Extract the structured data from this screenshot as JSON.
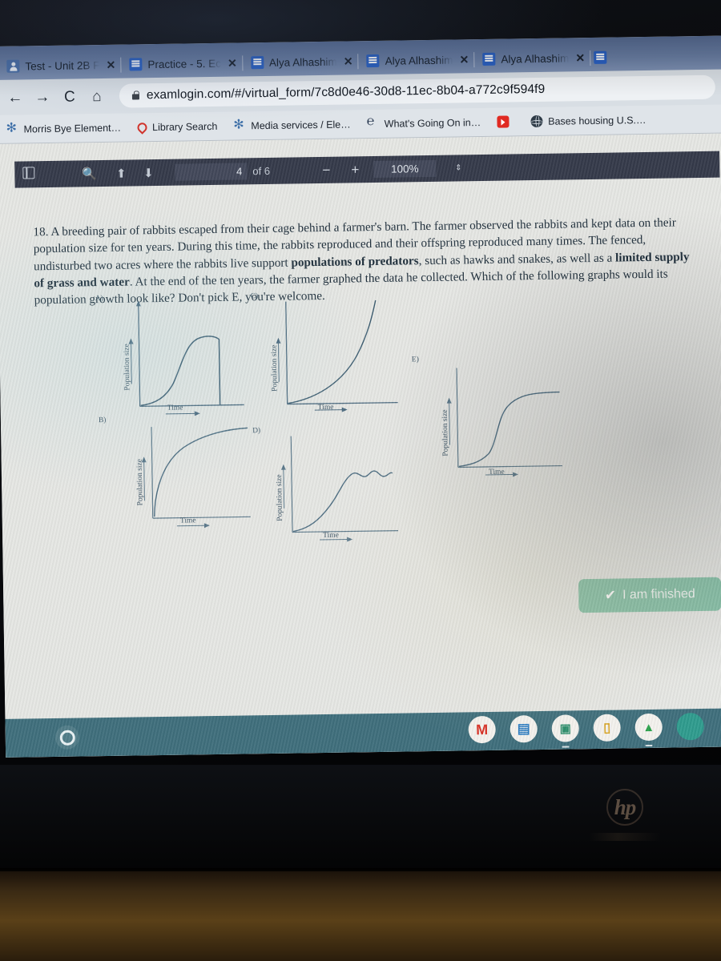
{
  "browser": {
    "tabs": [
      {
        "title": "Test - Unit 2B F",
        "favicon": "person-icon",
        "active": false,
        "close": "✕"
      },
      {
        "title": "Practice - 5. Ec",
        "favicon": "docs-icon",
        "active": false,
        "close": "✕"
      },
      {
        "title": "Alya Alhashim",
        "favicon": "docs-icon",
        "active": false,
        "close": "✕"
      },
      {
        "title": "Alya Alhashim",
        "favicon": "docs-icon",
        "active": false,
        "close": "✕"
      },
      {
        "title": "Alya Alhashim",
        "favicon": "docs-icon",
        "active": false,
        "close": "✕"
      },
      {
        "title": "",
        "favicon": "docs-icon",
        "active": false,
        "close": ""
      }
    ],
    "nav": {
      "back": "←",
      "forward": "→",
      "reload": "C",
      "home": "⌂"
    },
    "omnibox": {
      "url": "examlogin.com/#/virtual_form/7c8d0e46-30d8-11ec-8b04-a772c9f594f9",
      "lock_icon": "lock-icon"
    },
    "bookmarks": [
      {
        "label": "Morris Bye Element…",
        "icon": "leaf-icon"
      },
      {
        "label": "Library Search",
        "icon": "drop-icon"
      },
      {
        "label": "Media services / Ele…",
        "icon": "leaf-icon"
      },
      {
        "label": "What's Going On in…",
        "icon": "scroll-icon"
      },
      {
        "label": "",
        "icon": "youtube-icon"
      },
      {
        "label": "Bases housing U.S.…",
        "icon": "globe-icon"
      }
    ]
  },
  "pdf_toolbar": {
    "sidebar_toggle": "sidebar-toggle-icon",
    "find": "🔍",
    "prev_page": "⬆",
    "next_page": "⬇",
    "page_number": "4",
    "page_of": "of 6",
    "zoom_out": "−",
    "zoom_in": "+",
    "zoom_level": "100%",
    "zoom_select": "⇕"
  },
  "question": {
    "number": "18.",
    "part1": "18. A breeding pair of rabbits escaped from their cage behind a farmer's barn. The farmer observed the rabbits and kept data on their population size for ten years. During this time, the rabbits reproduced and their offspring reproduced many times. The fenced, undisturbed two acres where the rabbits live support ",
    "bold1": "populations of predators",
    "part2": ", such as hawks and snakes, as well as a ",
    "bold2": "limited supply of grass and water",
    "part3": ". At the end of the ten years, the farmer graphed the data he collected. Which of the following graphs would its population growth look like? Don't pick E, you're welcome."
  },
  "chart_data": [
    {
      "id": "A",
      "option_label": "A)",
      "type": "line",
      "title": "",
      "xlabel": "Time",
      "ylabel": "Population size",
      "description": "logistic rise to a peak followed by a sudden vertical crash",
      "x": [
        0,
        10,
        20,
        30,
        40,
        50,
        60,
        70,
        80,
        88,
        92,
        92
      ],
      "y": [
        0,
        3,
        7,
        14,
        27,
        45,
        62,
        73,
        78,
        79,
        78,
        0
      ],
      "xlim": [
        0,
        100
      ],
      "ylim": [
        0,
        100
      ],
      "grid": false
    },
    {
      "id": "B",
      "option_label": "B)",
      "type": "line",
      "title": "",
      "xlabel": "Time",
      "ylabel": "Population size",
      "description": "near-vertical initial rise then concave plateau (saturation)",
      "x": [
        5,
        6,
        10,
        18,
        30,
        45,
        60,
        78,
        95
      ],
      "y": [
        0,
        22,
        45,
        62,
        74,
        82,
        87,
        90,
        92
      ],
      "xlim": [
        0,
        100
      ],
      "ylim": [
        0,
        100
      ],
      "grid": false
    },
    {
      "id": "C",
      "option_label": "C)",
      "type": "line",
      "title": "",
      "xlabel": "Time",
      "ylabel": "Population size",
      "description": "exponential J-curve, no plateau",
      "x": [
        0,
        15,
        30,
        45,
        58,
        68,
        76,
        82,
        86,
        88
      ],
      "y": [
        0,
        4,
        10,
        19,
        31,
        45,
        62,
        80,
        94,
        100
      ],
      "xlim": [
        0,
        100
      ],
      "ylim": [
        0,
        100
      ],
      "grid": false
    },
    {
      "id": "D",
      "option_label": "D)",
      "type": "line",
      "title": "",
      "xlabel": "Time",
      "ylabel": "Population size",
      "description": "logistic growth then oscillation around carrying capacity",
      "x": [
        0,
        12,
        24,
        36,
        46,
        54,
        60,
        64,
        68,
        72,
        76,
        80,
        84,
        88,
        92
      ],
      "y": [
        0,
        4,
        10,
        22,
        38,
        54,
        66,
        72,
        68,
        74,
        67,
        74,
        66,
        73,
        69
      ],
      "xlim": [
        0,
        100
      ],
      "ylim": [
        0,
        100
      ],
      "grid": false
    },
    {
      "id": "E",
      "option_label": "E)",
      "type": "line",
      "title": "",
      "xlabel": "Time",
      "ylabel": "Population size",
      "description": "classic sigmoid S-curve levelling at carrying capacity",
      "x": [
        0,
        12,
        24,
        34,
        40,
        45,
        50,
        56,
        64,
        74,
        86,
        96
      ],
      "y": [
        2,
        4,
        7,
        12,
        22,
        40,
        58,
        70,
        77,
        80,
        81,
        81
      ],
      "xlim": [
        0,
        100
      ],
      "ylim": [
        0,
        100
      ],
      "grid": false
    }
  ],
  "finish_button": {
    "label": "I am finished",
    "check_icon": "✔",
    "color": "#8cc4ac"
  },
  "shelf": {
    "launcher": "launcher-icon",
    "apps": [
      {
        "name": "gmail-icon",
        "glyph": "M"
      },
      {
        "name": "docs-icon",
        "glyph": "▤"
      },
      {
        "name": "classroom-icon",
        "glyph": "▣"
      },
      {
        "name": "keep-icon",
        "glyph": "▯"
      },
      {
        "name": "drive-icon",
        "glyph": "▲"
      },
      {
        "name": "app-icon",
        "glyph": ""
      }
    ]
  },
  "device": {
    "brand": "hp"
  }
}
